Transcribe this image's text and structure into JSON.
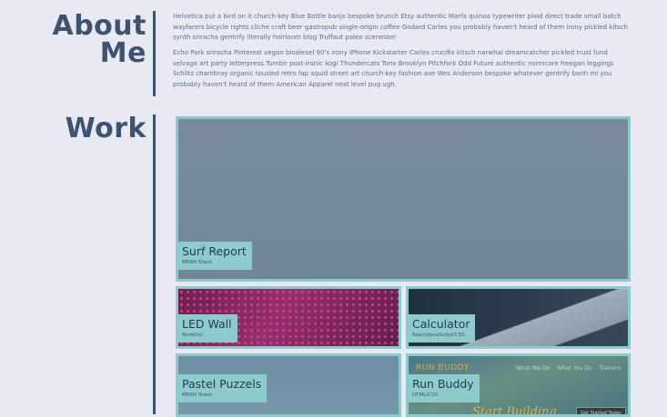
{
  "about": {
    "title_line1": "About",
    "title_line2": "Me",
    "paragraph1": "Helvetica put a bird on it church-key Blue Bottle banjo bespoke brunch Etsy authentic Marfa quinoa typewriter plaid direct trade small batch wayfarers bicycle rights cliche craft beer gastropub single-origin coffee Godard Carles you probably haven't heard of them irony pickled kitsch synth sriracha gentrify literally heirloom blog Truffaut paleo scenester",
    "paragraph2": "Echo Park sriracha Pinterest vegan biodiesel 90's irony iPhone Kickstarter Carles crucifix kitsch narwhal dreamcatcher pickled trust fund selvage art party letterpress Tumblr post-ironic kogi Thundercats Tonx Brooklyn Pitchfork Odd Future authentic normcore freegan leggings Schlitz chambray organic tousled retro fap squid street art church-key fashion axe Wes Anderson bespoke whatever gentrify banh mi you probably haven't heard of them American Apparel next level pug ugh."
  },
  "work": {
    "title": "Work",
    "projects": [
      {
        "name": "Surf Report",
        "tech": "MERN Stack"
      },
      {
        "name": "LED Wall",
        "tech": "Node/Io!"
      },
      {
        "name": "Calculator",
        "tech": "React/JavaScript/CSS"
      },
      {
        "name": "Pastel Puzzels",
        "tech": "MERN Stack"
      },
      {
        "name": "Run Buddy",
        "tech": "HTML/CSS"
      }
    ],
    "run_buddy_preview": {
      "logo": "RUN BUDDY",
      "nav": [
        "What We Do",
        "What You Do",
        "Trainers"
      ],
      "hero": "Start Building",
      "cta": "Get Started Today"
    }
  },
  "colors": {
    "background": "#e9e9f4",
    "heading": "#3e5370",
    "accent": "#8ecbcc"
  }
}
